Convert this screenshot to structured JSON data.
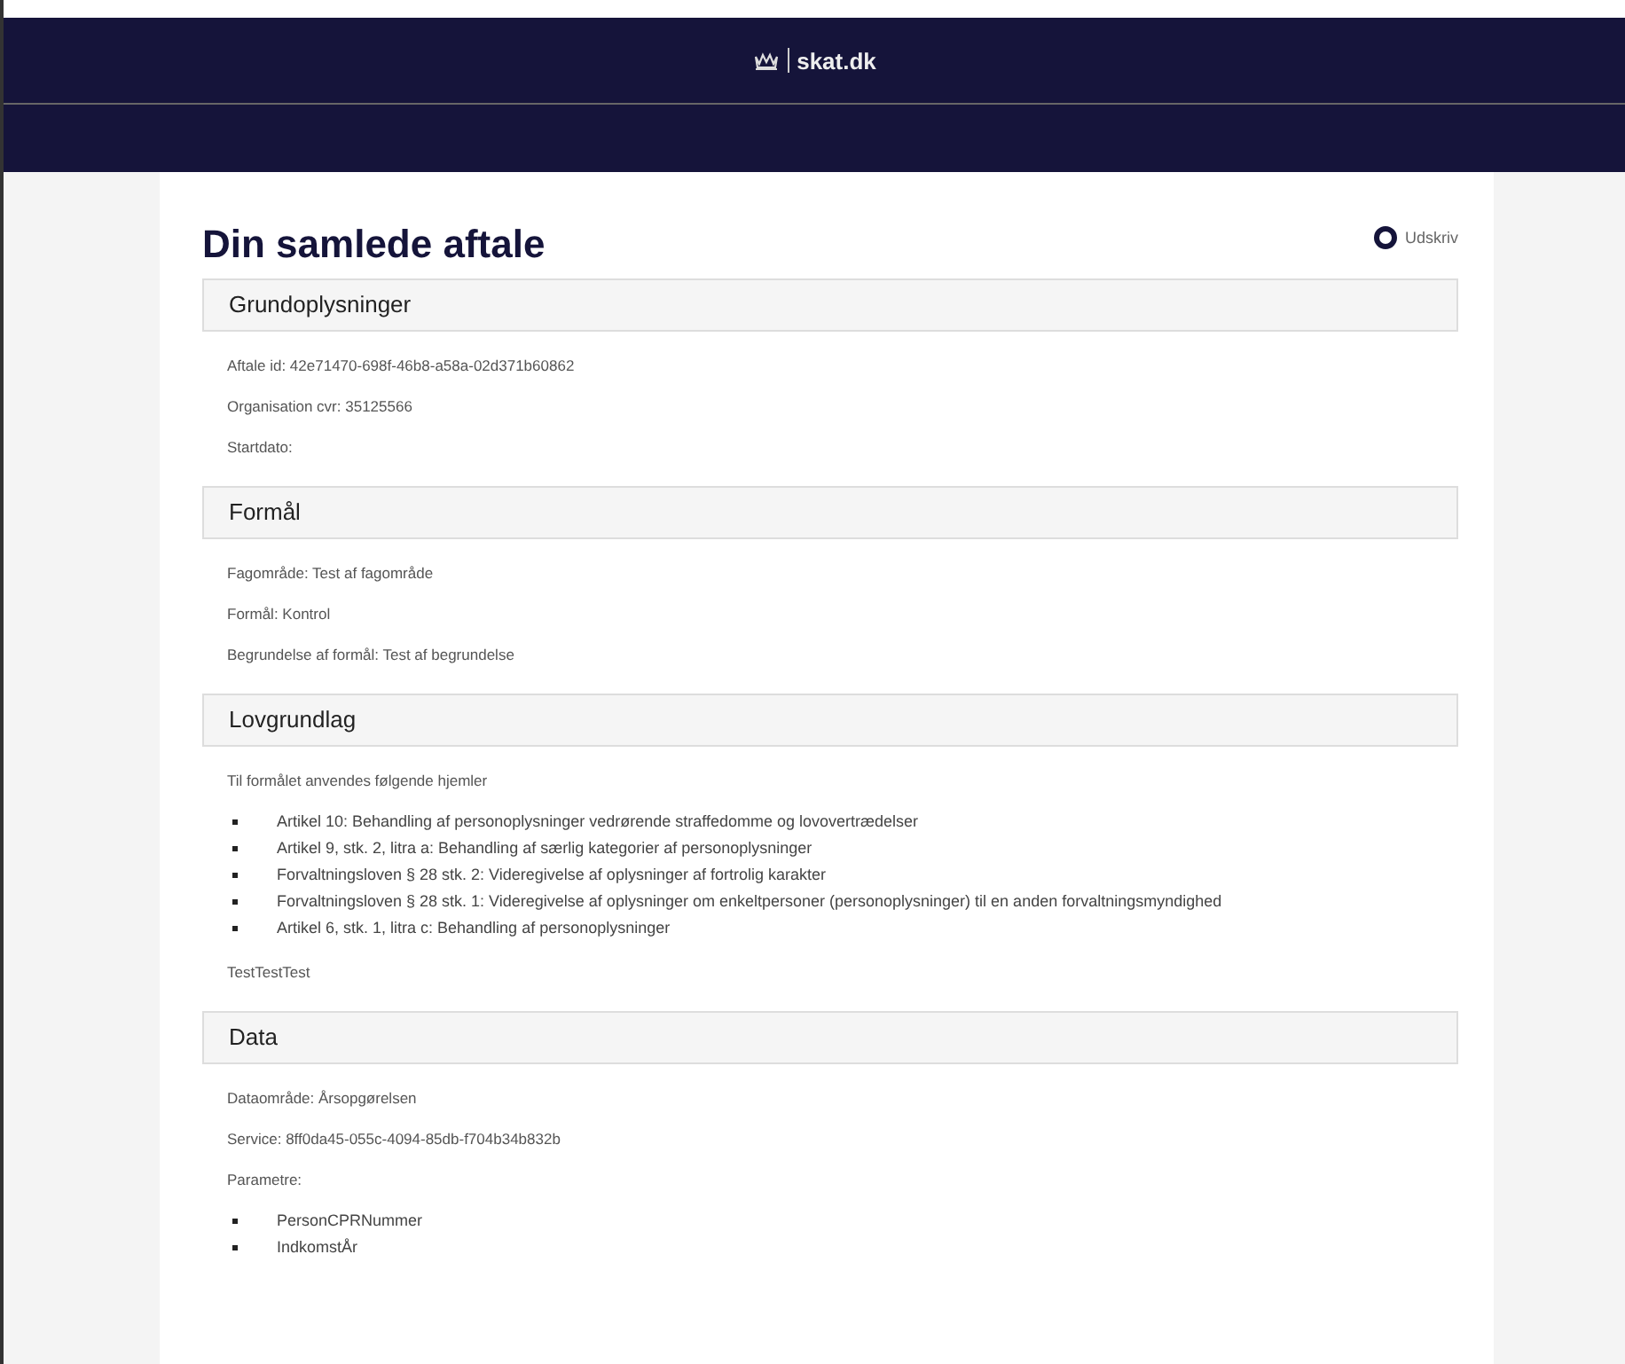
{
  "header": {
    "logo": "skat.dk"
  },
  "page": {
    "title": "Din samlede aftale",
    "print_label": "Udskriv"
  },
  "sections": [
    {
      "title": "Grundoplysninger",
      "blocks": [
        {
          "kind": "text",
          "text": "Aftale id: 42e71470-698f-46b8-a58a-02d371b60862"
        },
        {
          "kind": "text",
          "text": "Organisation cvr: 35125566"
        },
        {
          "kind": "text",
          "text": "Startdato:"
        }
      ]
    },
    {
      "title": "Formål",
      "blocks": [
        {
          "kind": "text",
          "text": "Fagområde: Test af fagområde"
        },
        {
          "kind": "text",
          "text": "Formål: Kontrol"
        },
        {
          "kind": "text",
          "text": "Begrundelse af formål: Test af begrundelse"
        }
      ]
    },
    {
      "title": "Lovgrundlag",
      "blocks": [
        {
          "kind": "text",
          "text": "Til formålet anvendes følgende hjemler"
        },
        {
          "kind": "list",
          "items": [
            "Artikel 10: Behandling af personoplysninger vedrørende straffedomme og lovovertrædelser",
            "Artikel 9, stk. 2, litra a: Behandling af særlig kategorier af personoplysninger",
            "Forvaltningsloven § 28 stk. 2: Videregivelse af oplysninger af fortrolig karakter",
            "Forvaltningsloven § 28 stk. 1: Videregivelse af oplysninger om enkeltpersoner (personoplysninger) til en anden forvaltningsmyndighed",
            "Artikel 6, stk. 1, litra c: Behandling af personoplysninger"
          ]
        },
        {
          "kind": "text",
          "text": "TestTestTest"
        }
      ]
    },
    {
      "title": "Data",
      "blocks": [
        {
          "kind": "text",
          "text": "Dataområde: Årsopgørelsen"
        },
        {
          "kind": "text",
          "text": "Service: 8ff0da45-055c-4094-85db-f704b34b832b"
        },
        {
          "kind": "text",
          "text": "Parametre:"
        },
        {
          "kind": "list",
          "items": [
            "PersonCPRNummer",
            "IndkomstÅr"
          ]
        }
      ]
    }
  ]
}
